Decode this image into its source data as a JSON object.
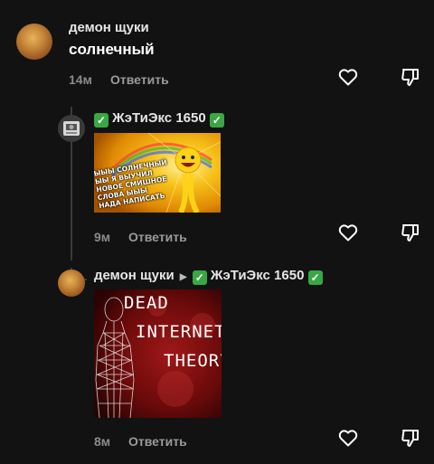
{
  "comments": [
    {
      "author": "демон щуки",
      "text": "солнечный",
      "time": "14м",
      "reply_label": "Ответить"
    },
    {
      "author": "ЖэТиЭкс 1650",
      "time": "9м",
      "reply_label": "Ответить",
      "image": {
        "caption": "ЫЫЫ СОЛНЕЧНЫЙ ЫЫ Я ВЫУЧИЛ НОВОЕ СМИШНОЕ СЛОВА ЫЫЫ НАДА НАПИСАТЬ"
      }
    },
    {
      "author": "демон щуки",
      "reply_to": "ЖэТиЭкс 1650",
      "time": "8м",
      "reply_label": "Ответить",
      "image": {
        "line1": "DEAD",
        "line2": "INTERNET",
        "line3": "THEORY"
      }
    }
  ],
  "colors": {
    "background": "#121212",
    "verified_badge": "#3aa745",
    "muted_text": "#8a8a8a"
  },
  "icons": [
    "heart-icon",
    "dislike-icon",
    "verified-check-icon",
    "reply-arrow-icon"
  ]
}
